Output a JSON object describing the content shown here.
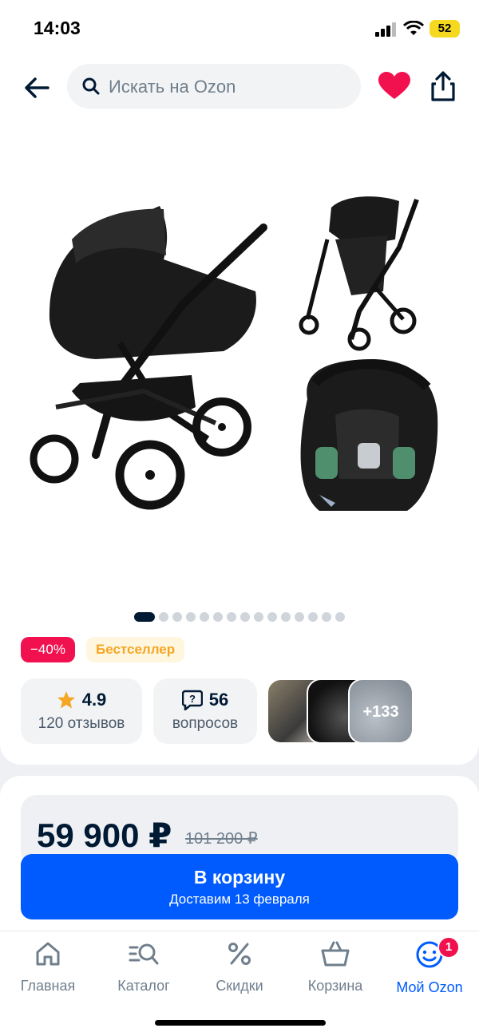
{
  "status_bar": {
    "time": "14:03",
    "battery": "52"
  },
  "header": {
    "search_placeholder": "Искать на Ozon"
  },
  "gallery": {
    "total_images": 15,
    "active_index": 0
  },
  "badges": {
    "discount": "−40%",
    "bestseller": "Бестселлер"
  },
  "rating": {
    "value": "4.9",
    "reviews": "120 отзывов"
  },
  "questions": {
    "count": "56",
    "label": "вопросов"
  },
  "photos": {
    "more_label": "+133"
  },
  "price": {
    "current": "59 900 ₽",
    "old": "101 200 ₽"
  },
  "cart_button": {
    "label": "В корзину",
    "delivery": "Доставим 13 февраля"
  },
  "bottom_nav": {
    "items": [
      {
        "label": "Главная",
        "icon": "home-icon"
      },
      {
        "label": "Каталог",
        "icon": "catalog-search-icon"
      },
      {
        "label": "Скидки",
        "icon": "percent-icon"
      },
      {
        "label": "Корзина",
        "icon": "basket-icon"
      },
      {
        "label": "Мой Ozon",
        "icon": "smiley-face-icon"
      }
    ],
    "profile_badge": "1"
  },
  "colors": {
    "brand_blue": "#005bff",
    "discount_red": "#f1114f",
    "heart_red": "#f1114f",
    "bestseller_orange": "#f5a623"
  }
}
